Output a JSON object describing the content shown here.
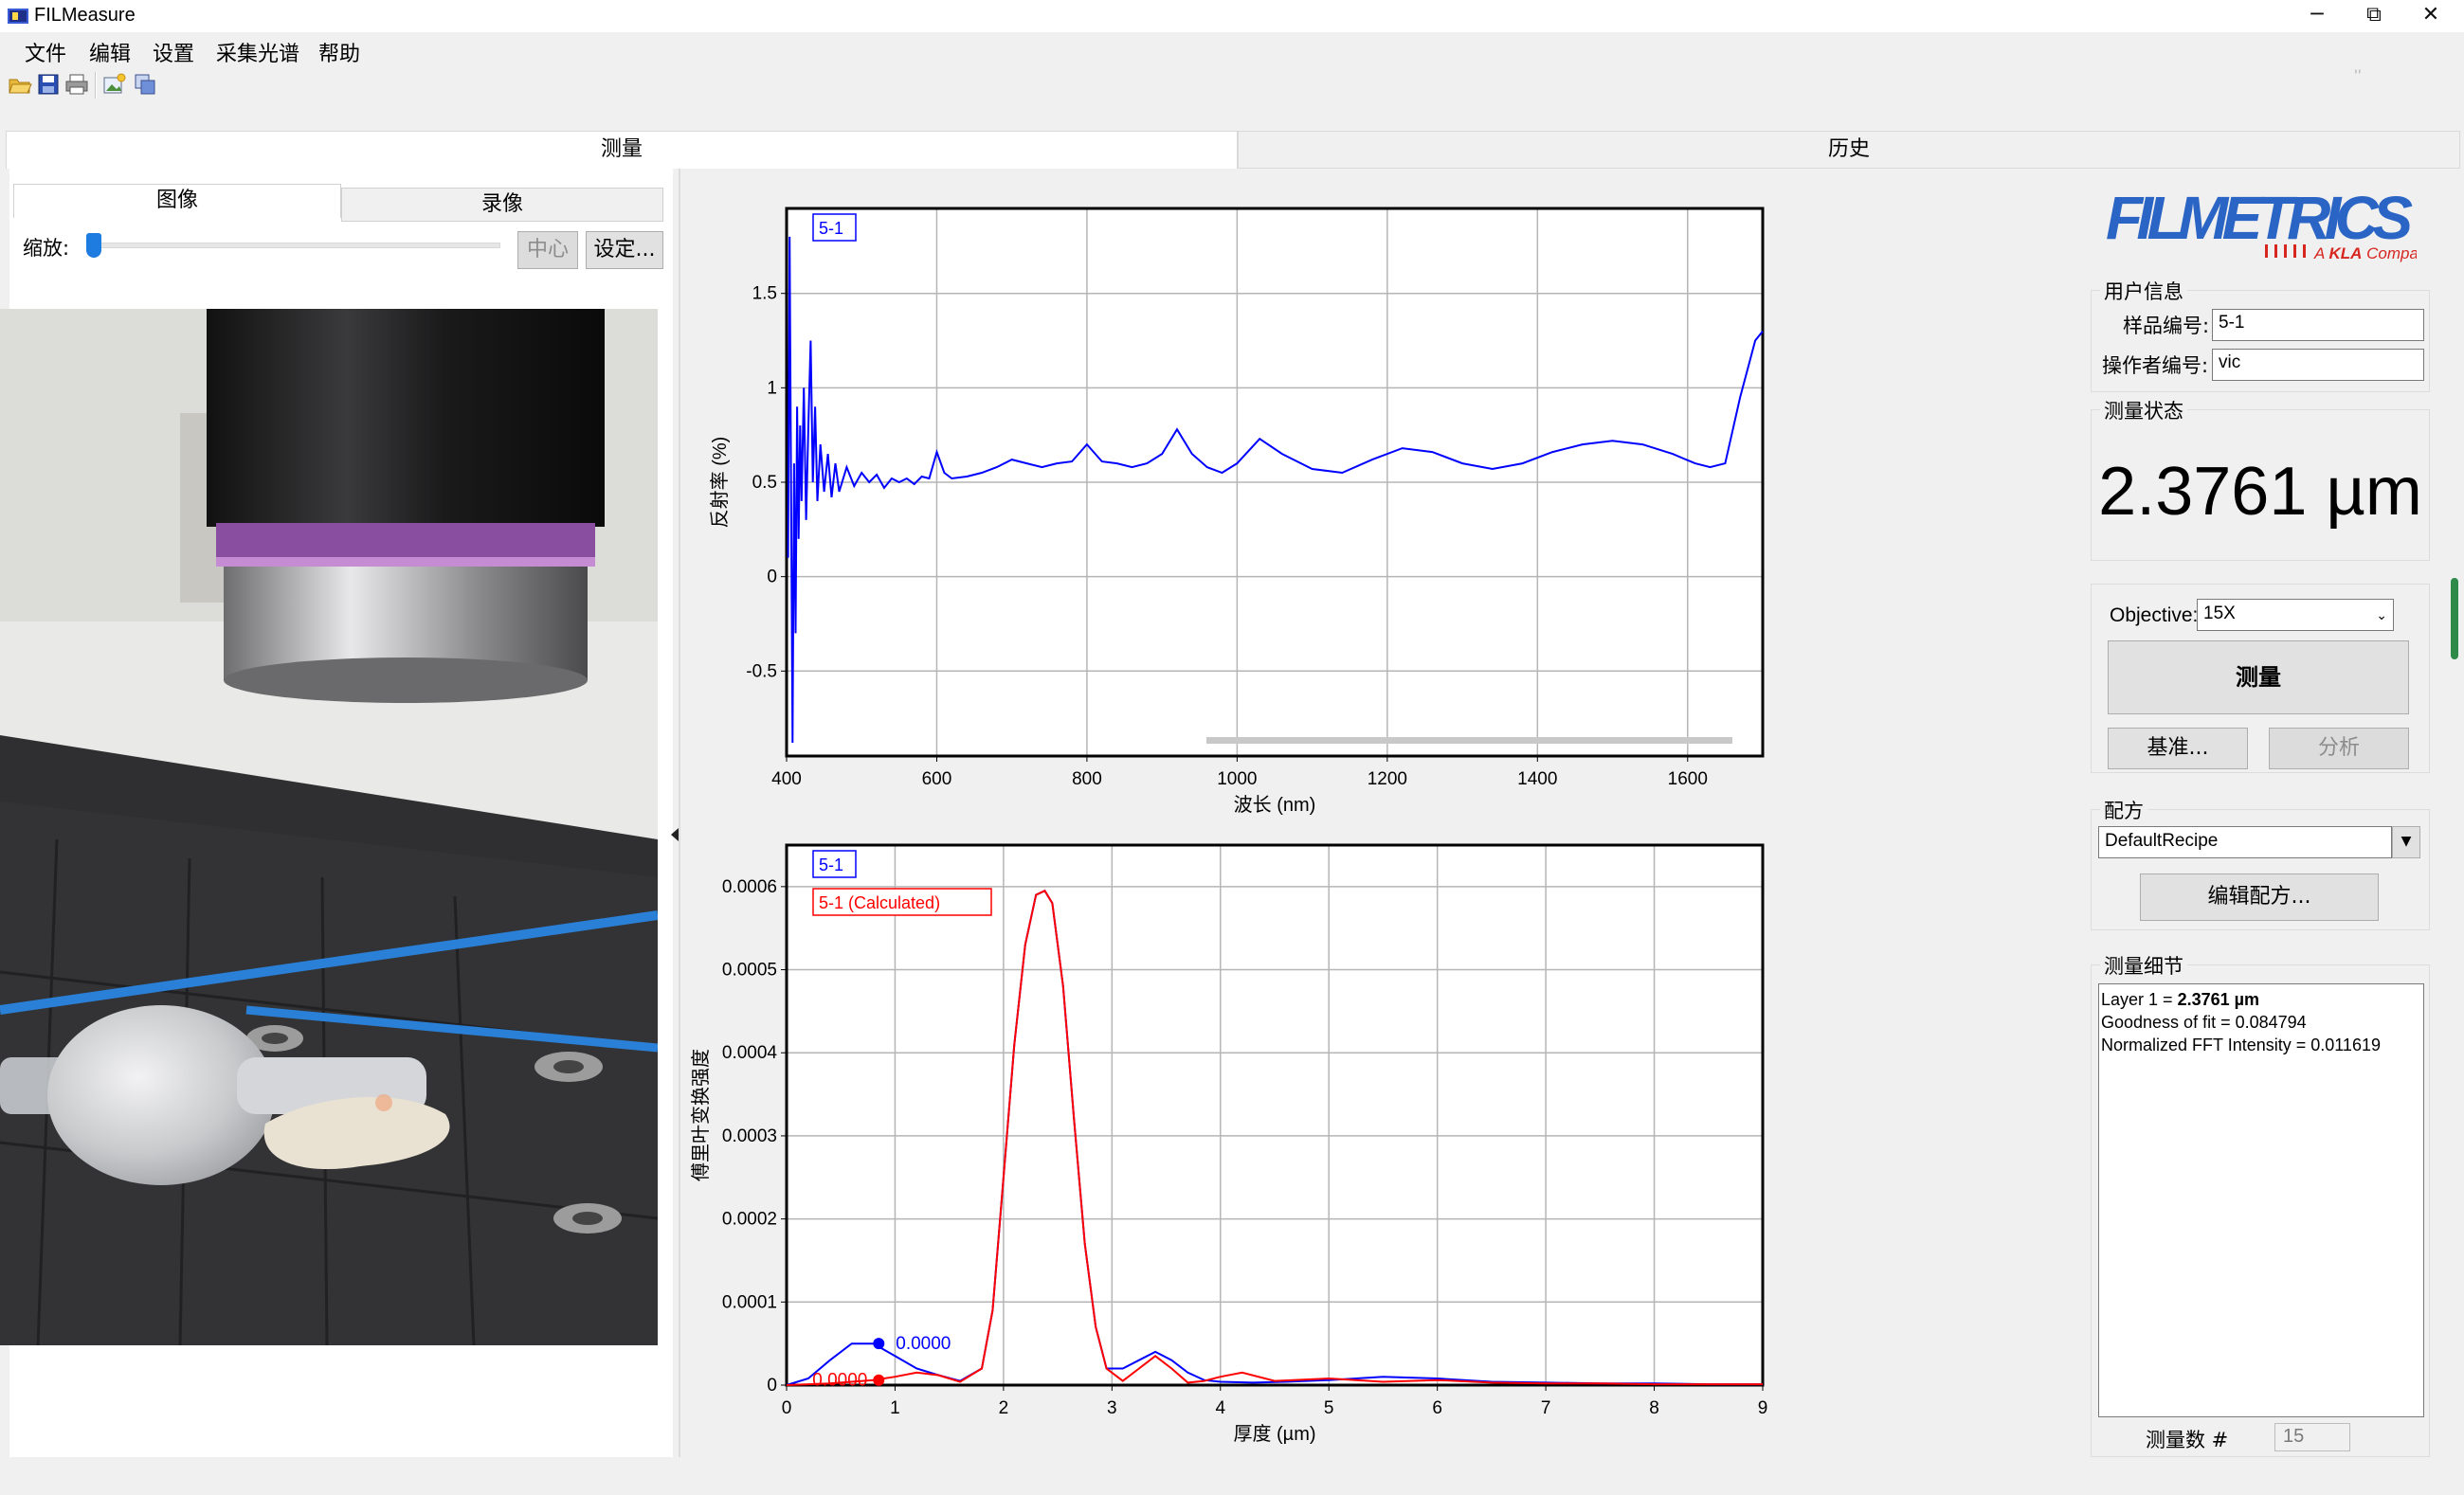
{
  "window": {
    "title": "FILMeasure",
    "minimize": "─",
    "maximize": "⧉",
    "close": "✕"
  },
  "menu": [
    "文件",
    "编辑",
    "设置",
    "采集光谱",
    "帮助"
  ],
  "toolbar": [
    "open-icon",
    "save-icon",
    "print-icon",
    "image-icon",
    "copy-icon"
  ],
  "main_tabs": {
    "measure": "测量",
    "history": "历史"
  },
  "left": {
    "tabs": {
      "image": "图像",
      "video": "录像"
    },
    "zoom_label": "缩放:",
    "center_button": "中心",
    "settings_button": "设定...",
    "zoom_value": 0
  },
  "chart_data": [
    {
      "type": "line",
      "xlabel": "波长 (nm)",
      "ylabel": "反射率 (%)",
      "legend": [
        "5-1"
      ],
      "xlim": [
        400,
        1700
      ],
      "ylim": [
        -0.95,
        1.95
      ],
      "x_ticks": [
        "400",
        "600",
        "800",
        "1000",
        "1200",
        "1400",
        "1600"
      ],
      "y_ticks": [
        "1.5",
        "1",
        "0.5",
        "0",
        "-0.5"
      ],
      "grid": true,
      "series": [
        {
          "name": "5-1",
          "color": "#0000ff",
          "x": [
            402,
            404,
            406,
            408,
            410,
            412,
            414,
            416,
            418,
            420,
            423,
            426,
            429,
            432,
            435,
            438,
            441,
            445,
            450,
            455,
            460,
            465,
            470,
            480,
            490,
            500,
            510,
            520,
            530,
            540,
            550,
            560,
            570,
            580,
            590,
            600,
            610,
            620,
            640,
            660,
            680,
            700,
            720,
            740,
            760,
            780,
            800,
            820,
            840,
            860,
            880,
            900,
            920,
            940,
            960,
            980,
            1000,
            1030,
            1060,
            1100,
            1140,
            1180,
            1220,
            1260,
            1300,
            1340,
            1380,
            1420,
            1460,
            1500,
            1540,
            1580,
            1610,
            1630,
            1650,
            1670,
            1690,
            1700
          ],
          "y": [
            0.1,
            1.8,
            0.4,
            -0.88,
            0.6,
            -0.3,
            0.9,
            0.2,
            0.8,
            0.4,
            1.0,
            0.3,
            0.8,
            1.25,
            0.5,
            0.9,
            0.4,
            0.7,
            0.45,
            0.65,
            0.42,
            0.6,
            0.45,
            0.58,
            0.48,
            0.55,
            0.5,
            0.54,
            0.47,
            0.52,
            0.5,
            0.52,
            0.49,
            0.53,
            0.52,
            0.66,
            0.55,
            0.52,
            0.53,
            0.55,
            0.58,
            0.62,
            0.6,
            0.58,
            0.6,
            0.61,
            0.7,
            0.61,
            0.6,
            0.58,
            0.6,
            0.65,
            0.78,
            0.65,
            0.58,
            0.55,
            0.6,
            0.73,
            0.65,
            0.57,
            0.55,
            0.62,
            0.68,
            0.66,
            0.6,
            0.57,
            0.6,
            0.66,
            0.7,
            0.72,
            0.7,
            0.65,
            0.6,
            0.58,
            0.6,
            0.95,
            1.25,
            1.3
          ]
        }
      ]
    },
    {
      "type": "line",
      "xlabel": "厚度 (µm)",
      "ylabel": "傅里叶变换强度",
      "legend": [
        "5-1",
        "5-1 (Calculated)"
      ],
      "xlim": [
        0,
        9
      ],
      "ylim": [
        0,
        0.00065
      ],
      "x_ticks": [
        "0",
        "1",
        "2",
        "3",
        "4",
        "5",
        "6",
        "7",
        "8",
        "9"
      ],
      "y_ticks": [
        "0.0006",
        "0.0005",
        "0.0004",
        "0.0003",
        "0.0002",
        "0.0001",
        "0"
      ],
      "grid": true,
      "series": [
        {
          "name": "5-1",
          "color": "#0000ff",
          "x": [
            0,
            0.2,
            0.4,
            0.6,
            0.8,
            1.0,
            1.2,
            1.4,
            1.6,
            1.8,
            1.9,
            2.0,
            2.1,
            2.2,
            2.3,
            2.38,
            2.45,
            2.55,
            2.65,
            2.75,
            2.85,
            2.95,
            3.1,
            3.25,
            3.4,
            3.55,
            3.7,
            3.85,
            4.0,
            4.3,
            4.6,
            5.0,
            5.5,
            6.0,
            6.5,
            7.0,
            7.5,
            8.0,
            8.5,
            9.0
          ],
          "y": [
            0,
            8e-06,
            3e-05,
            5e-05,
            5e-05,
            3.5e-05,
            2e-05,
            1.2e-05,
            5e-06,
            2e-05,
            9e-05,
            0.00025,
            0.00041,
            0.00053,
            0.00059,
            0.000595,
            0.00058,
            0.00048,
            0.00032,
            0.00017,
            7e-05,
            2e-05,
            2e-05,
            3e-05,
            4e-05,
            3e-05,
            1.5e-05,
            6e-06,
            4e-06,
            3e-06,
            4e-06,
            6e-06,
            1e-05,
            8e-06,
            4e-06,
            3e-06,
            2e-06,
            2e-06,
            1e-06,
            1e-06
          ]
        },
        {
          "name": "5-1 (Calculated)",
          "color": "#ff0000",
          "x": [
            0,
            0.2,
            0.4,
            0.6,
            0.8,
            1.0,
            1.2,
            1.4,
            1.6,
            1.8,
            1.9,
            2.0,
            2.1,
            2.2,
            2.3,
            2.38,
            2.45,
            2.55,
            2.65,
            2.75,
            2.85,
            2.95,
            3.1,
            3.25,
            3.4,
            3.55,
            3.7,
            3.85,
            4.0,
            4.2,
            4.5,
            5.0,
            5.5,
            6.0,
            6.5,
            7.0,
            7.5,
            8.0,
            8.5,
            9.0
          ],
          "y": [
            0,
            1e-06,
            2e-06,
            4e-06,
            6e-06,
            1e-05,
            1.5e-05,
            1.2e-05,
            4e-06,
            2e-05,
            9e-05,
            0.00025,
            0.00041,
            0.00053,
            0.00059,
            0.000595,
            0.00058,
            0.00048,
            0.00032,
            0.00017,
            7e-05,
            2e-05,
            5e-06,
            2e-05,
            3.5e-05,
            2e-05,
            3e-06,
            5e-06,
            1e-05,
            1.5e-05,
            5e-06,
            8e-06,
            4e-06,
            6e-06,
            3e-06,
            2e-06,
            2e-06,
            1e-06,
            1e-06,
            1e-06
          ]
        }
      ],
      "markers": [
        {
          "series": "5-1",
          "x": 0.85,
          "label": "0.0000"
        },
        {
          "series": "5-1 (Calculated)",
          "x": 0.85,
          "label": "0.0000"
        }
      ]
    }
  ],
  "right": {
    "logo_text": "FILMETRICS",
    "logo_sub": "A KLA Company",
    "user_info_title": "用户信息",
    "sample_label": "样品编号:",
    "sample_value": "5-1",
    "operator_label": "操作者编号:",
    "operator_value": "vic",
    "status_title": "测量状态",
    "result": "2.3761 µm",
    "objective_label": "Objective:",
    "objective_value": "15X",
    "measure_button": "测量",
    "baseline_button": "基准...",
    "analyze_button": "分析",
    "recipe_title": "配方",
    "recipe_value": "DefaultRecipe",
    "edit_recipe_button": "编辑配方...",
    "details_title": "测量细节",
    "details": {
      "layer_prefix": "Layer 1 = ",
      "layer_value": "2.3761 µm",
      "goodness": "Goodness of fit = 0.084794",
      "fft": "Normalized FFT Intensity = 0.011619"
    },
    "count_label": "测量数 #",
    "count_value": "15"
  },
  "colors": {
    "accent_blue": "#1e7be0",
    "logo_blue": "#2a64c4",
    "logo_red": "#d6261f"
  }
}
